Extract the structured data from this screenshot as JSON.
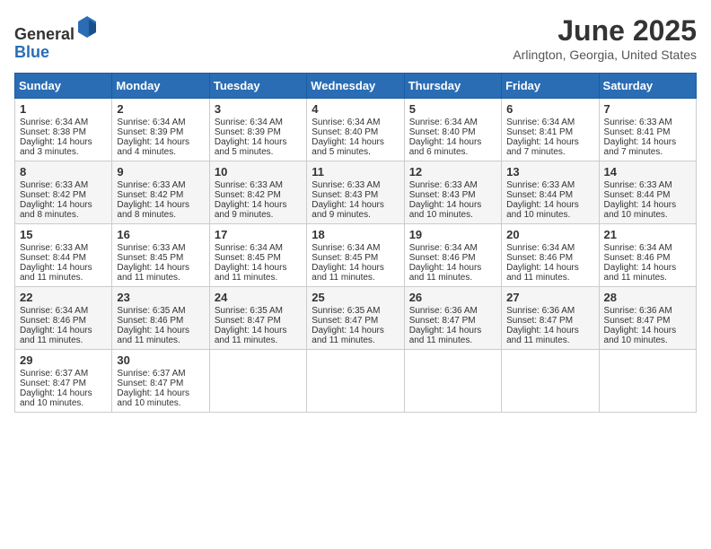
{
  "header": {
    "logo_line1": "General",
    "logo_line2": "Blue",
    "month_title": "June 2025",
    "location": "Arlington, Georgia, United States"
  },
  "days_of_week": [
    "Sunday",
    "Monday",
    "Tuesday",
    "Wednesday",
    "Thursday",
    "Friday",
    "Saturday"
  ],
  "weeks": [
    [
      {
        "day": "1",
        "sunrise": "Sunrise: 6:34 AM",
        "sunset": "Sunset: 8:38 PM",
        "daylight": "Daylight: 14 hours and 3 minutes."
      },
      {
        "day": "2",
        "sunrise": "Sunrise: 6:34 AM",
        "sunset": "Sunset: 8:39 PM",
        "daylight": "Daylight: 14 hours and 4 minutes."
      },
      {
        "day": "3",
        "sunrise": "Sunrise: 6:34 AM",
        "sunset": "Sunset: 8:39 PM",
        "daylight": "Daylight: 14 hours and 5 minutes."
      },
      {
        "day": "4",
        "sunrise": "Sunrise: 6:34 AM",
        "sunset": "Sunset: 8:40 PM",
        "daylight": "Daylight: 14 hours and 5 minutes."
      },
      {
        "day": "5",
        "sunrise": "Sunrise: 6:34 AM",
        "sunset": "Sunset: 8:40 PM",
        "daylight": "Daylight: 14 hours and 6 minutes."
      },
      {
        "day": "6",
        "sunrise": "Sunrise: 6:34 AM",
        "sunset": "Sunset: 8:41 PM",
        "daylight": "Daylight: 14 hours and 7 minutes."
      },
      {
        "day": "7",
        "sunrise": "Sunrise: 6:33 AM",
        "sunset": "Sunset: 8:41 PM",
        "daylight": "Daylight: 14 hours and 7 minutes."
      }
    ],
    [
      {
        "day": "8",
        "sunrise": "Sunrise: 6:33 AM",
        "sunset": "Sunset: 8:42 PM",
        "daylight": "Daylight: 14 hours and 8 minutes."
      },
      {
        "day": "9",
        "sunrise": "Sunrise: 6:33 AM",
        "sunset": "Sunset: 8:42 PM",
        "daylight": "Daylight: 14 hours and 8 minutes."
      },
      {
        "day": "10",
        "sunrise": "Sunrise: 6:33 AM",
        "sunset": "Sunset: 8:42 PM",
        "daylight": "Daylight: 14 hours and 9 minutes."
      },
      {
        "day": "11",
        "sunrise": "Sunrise: 6:33 AM",
        "sunset": "Sunset: 8:43 PM",
        "daylight": "Daylight: 14 hours and 9 minutes."
      },
      {
        "day": "12",
        "sunrise": "Sunrise: 6:33 AM",
        "sunset": "Sunset: 8:43 PM",
        "daylight": "Daylight: 14 hours and 10 minutes."
      },
      {
        "day": "13",
        "sunrise": "Sunrise: 6:33 AM",
        "sunset": "Sunset: 8:44 PM",
        "daylight": "Daylight: 14 hours and 10 minutes."
      },
      {
        "day": "14",
        "sunrise": "Sunrise: 6:33 AM",
        "sunset": "Sunset: 8:44 PM",
        "daylight": "Daylight: 14 hours and 10 minutes."
      }
    ],
    [
      {
        "day": "15",
        "sunrise": "Sunrise: 6:33 AM",
        "sunset": "Sunset: 8:44 PM",
        "daylight": "Daylight: 14 hours and 11 minutes."
      },
      {
        "day": "16",
        "sunrise": "Sunrise: 6:33 AM",
        "sunset": "Sunset: 8:45 PM",
        "daylight": "Daylight: 14 hours and 11 minutes."
      },
      {
        "day": "17",
        "sunrise": "Sunrise: 6:34 AM",
        "sunset": "Sunset: 8:45 PM",
        "daylight": "Daylight: 14 hours and 11 minutes."
      },
      {
        "day": "18",
        "sunrise": "Sunrise: 6:34 AM",
        "sunset": "Sunset: 8:45 PM",
        "daylight": "Daylight: 14 hours and 11 minutes."
      },
      {
        "day": "19",
        "sunrise": "Sunrise: 6:34 AM",
        "sunset": "Sunset: 8:46 PM",
        "daylight": "Daylight: 14 hours and 11 minutes."
      },
      {
        "day": "20",
        "sunrise": "Sunrise: 6:34 AM",
        "sunset": "Sunset: 8:46 PM",
        "daylight": "Daylight: 14 hours and 11 minutes."
      },
      {
        "day": "21",
        "sunrise": "Sunrise: 6:34 AM",
        "sunset": "Sunset: 8:46 PM",
        "daylight": "Daylight: 14 hours and 11 minutes."
      }
    ],
    [
      {
        "day": "22",
        "sunrise": "Sunrise: 6:34 AM",
        "sunset": "Sunset: 8:46 PM",
        "daylight": "Daylight: 14 hours and 11 minutes."
      },
      {
        "day": "23",
        "sunrise": "Sunrise: 6:35 AM",
        "sunset": "Sunset: 8:46 PM",
        "daylight": "Daylight: 14 hours and 11 minutes."
      },
      {
        "day": "24",
        "sunrise": "Sunrise: 6:35 AM",
        "sunset": "Sunset: 8:47 PM",
        "daylight": "Daylight: 14 hours and 11 minutes."
      },
      {
        "day": "25",
        "sunrise": "Sunrise: 6:35 AM",
        "sunset": "Sunset: 8:47 PM",
        "daylight": "Daylight: 14 hours and 11 minutes."
      },
      {
        "day": "26",
        "sunrise": "Sunrise: 6:36 AM",
        "sunset": "Sunset: 8:47 PM",
        "daylight": "Daylight: 14 hours and 11 minutes."
      },
      {
        "day": "27",
        "sunrise": "Sunrise: 6:36 AM",
        "sunset": "Sunset: 8:47 PM",
        "daylight": "Daylight: 14 hours and 11 minutes."
      },
      {
        "day": "28",
        "sunrise": "Sunrise: 6:36 AM",
        "sunset": "Sunset: 8:47 PM",
        "daylight": "Daylight: 14 hours and 10 minutes."
      }
    ],
    [
      {
        "day": "29",
        "sunrise": "Sunrise: 6:37 AM",
        "sunset": "Sunset: 8:47 PM",
        "daylight": "Daylight: 14 hours and 10 minutes."
      },
      {
        "day": "30",
        "sunrise": "Sunrise: 6:37 AM",
        "sunset": "Sunset: 8:47 PM",
        "daylight": "Daylight: 14 hours and 10 minutes."
      },
      {
        "day": "",
        "sunrise": "",
        "sunset": "",
        "daylight": ""
      },
      {
        "day": "",
        "sunrise": "",
        "sunset": "",
        "daylight": ""
      },
      {
        "day": "",
        "sunrise": "",
        "sunset": "",
        "daylight": ""
      },
      {
        "day": "",
        "sunrise": "",
        "sunset": "",
        "daylight": ""
      },
      {
        "day": "",
        "sunrise": "",
        "sunset": "",
        "daylight": ""
      }
    ]
  ]
}
